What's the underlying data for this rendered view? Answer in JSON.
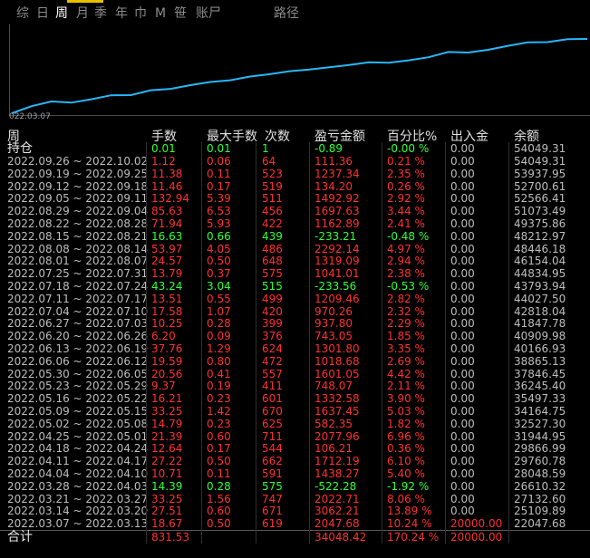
{
  "tabs": [
    "综",
    "日",
    "周",
    "月",
    "季",
    "年",
    "巾",
    "M",
    "笹",
    "账尸",
    "路径"
  ],
  "active_tab": 2,
  "chart": {
    "start_date": "022.03.07",
    "line_color": "#29b6f6",
    "balances": [
      22047.68,
      25109.89,
      27132.6,
      26610.32,
      28048.59,
      29760.78,
      29866.99,
      31944.95,
      32527.3,
      34164.75,
      35497.33,
      36245.4,
      37846.45,
      38865.13,
      40166.93,
      40909.98,
      41847.78,
      42818.04,
      44027.5,
      43793.94,
      44834.95,
      46154.04,
      48446.18,
      48212.97,
      49375.86,
      51073.49,
      52566.41,
      52700.61,
      53937.95,
      54049.31
    ]
  },
  "headers": {
    "week": "周",
    "lots": "手数",
    "max_lots": "最大手数",
    "count": "次数",
    "pnl": "盈亏金额",
    "pct": "百分比%",
    "cash": "出入金",
    "balance": "余额"
  },
  "holding": {
    "week": "持仓",
    "lots": "0.01",
    "max_lots": "0.01",
    "count": "1",
    "pnl": "-0.89",
    "pct": "-0.00 %",
    "cash": "0.00",
    "balance": "54049.31",
    "sign": "pos"
  },
  "rows": [
    {
      "week": "2022.09.26 ~ 2022.10.02",
      "lots": "1.12",
      "max_lots": "0.06",
      "count": "64",
      "pnl": "111.36",
      "pct": "0.21 %",
      "cash": "0.00",
      "balance": "54049.31",
      "sign": "neg"
    },
    {
      "week": "2022.09.19 ~ 2022.09.25",
      "lots": "11.38",
      "max_lots": "0.11",
      "count": "523",
      "pnl": "1237.34",
      "pct": "2.35 %",
      "cash": "0.00",
      "balance": "53937.95",
      "sign": "neg"
    },
    {
      "week": "2022.09.12 ~ 2022.09.18",
      "lots": "11.46",
      "max_lots": "0.17",
      "count": "519",
      "pnl": "134.20",
      "pct": "0.26 %",
      "cash": "0.00",
      "balance": "52700.61",
      "sign": "neg"
    },
    {
      "week": "2022.09.05 ~ 2022.09.11",
      "lots": "132.94",
      "max_lots": "5.39",
      "count": "511",
      "pnl": "1492.92",
      "pct": "2.92 %",
      "cash": "0.00",
      "balance": "52566.41",
      "sign": "neg"
    },
    {
      "week": "2022.08.29 ~ 2022.09.04",
      "lots": "85.63",
      "max_lots": "6.53",
      "count": "456",
      "pnl": "1697.63",
      "pct": "3.44 %",
      "cash": "0.00",
      "balance": "51073.49",
      "sign": "neg"
    },
    {
      "week": "2022.08.22 ~ 2022.08.28",
      "lots": "71.94",
      "max_lots": "5.93",
      "count": "422",
      "pnl": "1162.89",
      "pct": "2.41 %",
      "cash": "0.00",
      "balance": "49375.86",
      "sign": "neg"
    },
    {
      "week": "2022.08.15 ~ 2022.08.21",
      "lots": "16.63",
      "max_lots": "0.66",
      "count": "439",
      "pnl": "-233.21",
      "pct": "-0.48 %",
      "cash": "0.00",
      "balance": "48212.97",
      "sign": "pos"
    },
    {
      "week": "2022.08.08 ~ 2022.08.14",
      "lots": "53.97",
      "max_lots": "4.05",
      "count": "486",
      "pnl": "2292.14",
      "pct": "4.97 %",
      "cash": "0.00",
      "balance": "48446.18",
      "sign": "neg"
    },
    {
      "week": "2022.08.01 ~ 2022.08.07",
      "lots": "24.57",
      "max_lots": "0.50",
      "count": "648",
      "pnl": "1319.09",
      "pct": "2.94 %",
      "cash": "0.00",
      "balance": "46154.04",
      "sign": "neg"
    },
    {
      "week": "2022.07.25 ~ 2022.07.31",
      "lots": "13.79",
      "max_lots": "0.37",
      "count": "575",
      "pnl": "1041.01",
      "pct": "2.38 %",
      "cash": "0.00",
      "balance": "44834.95",
      "sign": "neg"
    },
    {
      "week": "2022.07.18 ~ 2022.07.24",
      "lots": "43.24",
      "max_lots": "3.04",
      "count": "515",
      "pnl": "-233.56",
      "pct": "-0.53 %",
      "cash": "0.00",
      "balance": "43793.94",
      "sign": "pos"
    },
    {
      "week": "2022.07.11 ~ 2022.07.17",
      "lots": "13.51",
      "max_lots": "0.55",
      "count": "499",
      "pnl": "1209.46",
      "pct": "2.82 %",
      "cash": "0.00",
      "balance": "44027.50",
      "sign": "neg"
    },
    {
      "week": "2022.07.04 ~ 2022.07.10",
      "lots": "17.58",
      "max_lots": "1.07",
      "count": "420",
      "pnl": "970.26",
      "pct": "2.32 %",
      "cash": "0.00",
      "balance": "42818.04",
      "sign": "neg"
    },
    {
      "week": "2022.06.27 ~ 2022.07.03",
      "lots": "10.25",
      "max_lots": "0.28",
      "count": "399",
      "pnl": "937.80",
      "pct": "2.29 %",
      "cash": "0.00",
      "balance": "41847.78",
      "sign": "neg"
    },
    {
      "week": "2022.06.20 ~ 2022.06.26",
      "lots": "6.20",
      "max_lots": "0.09",
      "count": "376",
      "pnl": "743.05",
      "pct": "1.85 %",
      "cash": "0.00",
      "balance": "40909.98",
      "sign": "neg"
    },
    {
      "week": "2022.06.13 ~ 2022.06.19",
      "lots": "37.76",
      "max_lots": "1.29",
      "count": "624",
      "pnl": "1301.80",
      "pct": "3.35 %",
      "cash": "0.00",
      "balance": "40166.93",
      "sign": "neg"
    },
    {
      "week": "2022.06.06 ~ 2022.06.12",
      "lots": "19.59",
      "max_lots": "0.80",
      "count": "472",
      "pnl": "1018.68",
      "pct": "2.69 %",
      "cash": "0.00",
      "balance": "38865.13",
      "sign": "neg"
    },
    {
      "week": "2022.05.30 ~ 2022.06.05",
      "lots": "20.56",
      "max_lots": "0.41",
      "count": "557",
      "pnl": "1601.05",
      "pct": "4.42 %",
      "cash": "0.00",
      "balance": "37846.45",
      "sign": "neg"
    },
    {
      "week": "2022.05.23 ~ 2022.05.29",
      "lots": "9.37",
      "max_lots": "0.19",
      "count": "411",
      "pnl": "748.07",
      "pct": "2.11 %",
      "cash": "0.00",
      "balance": "36245.40",
      "sign": "neg"
    },
    {
      "week": "2022.05.16 ~ 2022.05.22",
      "lots": "16.21",
      "max_lots": "0.23",
      "count": "601",
      "pnl": "1332.58",
      "pct": "3.90 %",
      "cash": "0.00",
      "balance": "35497.33",
      "sign": "neg"
    },
    {
      "week": "2022.05.09 ~ 2022.05.15",
      "lots": "33.25",
      "max_lots": "1.42",
      "count": "670",
      "pnl": "1637.45",
      "pct": "5.03 %",
      "cash": "0.00",
      "balance": "34164.75",
      "sign": "neg"
    },
    {
      "week": "2022.05.02 ~ 2022.05.08",
      "lots": "14.79",
      "max_lots": "0.23",
      "count": "625",
      "pnl": "582.35",
      "pct": "1.82 %",
      "cash": "0.00",
      "balance": "32527.30",
      "sign": "neg"
    },
    {
      "week": "2022.04.25 ~ 2022.05.01",
      "lots": "21.39",
      "max_lots": "0.60",
      "count": "711",
      "pnl": "2077.96",
      "pct": "6.96 %",
      "cash": "0.00",
      "balance": "31944.95",
      "sign": "neg"
    },
    {
      "week": "2022.04.18 ~ 2022.04.24",
      "lots": "12.64",
      "max_lots": "0.17",
      "count": "544",
      "pnl": "106.21",
      "pct": "0.36 %",
      "cash": "0.00",
      "balance": "29866.99",
      "sign": "neg"
    },
    {
      "week": "2022.04.11 ~ 2022.04.17",
      "lots": "27.22",
      "max_lots": "0.50",
      "count": "662",
      "pnl": "1712.19",
      "pct": "6.10 %",
      "cash": "0.00",
      "balance": "29760.78",
      "sign": "neg"
    },
    {
      "week": "2022.04.04 ~ 2022.04.10",
      "lots": "10.71",
      "max_lots": "0.11",
      "count": "591",
      "pnl": "1438.27",
      "pct": "5.40 %",
      "cash": "0.00",
      "balance": "28048.59",
      "sign": "neg"
    },
    {
      "week": "2022.03.28 ~ 2022.04.03",
      "lots": "14.39",
      "max_lots": "0.28",
      "count": "575",
      "pnl": "-522.28",
      "pct": "-1.92 %",
      "cash": "0.00",
      "balance": "26610.32",
      "sign": "pos"
    },
    {
      "week": "2022.03.21 ~ 2022.03.27",
      "lots": "33.25",
      "max_lots": "1.56",
      "count": "747",
      "pnl": "2022.71",
      "pct": "8.06 %",
      "cash": "0.00",
      "balance": "27132.60",
      "sign": "neg"
    },
    {
      "week": "2022.03.14 ~ 2022.03.20",
      "lots": "27.51",
      "max_lots": "0.60",
      "count": "671",
      "pnl": "3062.21",
      "pct": "13.89 %",
      "cash": "0.00",
      "balance": "25109.89",
      "sign": "neg"
    },
    {
      "week": "2022.03.07 ~ 2022.03.13",
      "lots": "18.67",
      "max_lots": "0.50",
      "count": "619",
      "pnl": "2047.68",
      "pct": "10.24 %",
      "cash": "20000.00",
      "balance": "22047.68",
      "sign": "neg",
      "cash_red": true
    }
  ],
  "total": {
    "week": "合计",
    "lots": "831.53",
    "max_lots": "",
    "count": "",
    "pnl": "34048.42",
    "pct": "170.24 %",
    "cash": "20000.00",
    "balance": "",
    "sign": "neg",
    "cash_red": true
  }
}
